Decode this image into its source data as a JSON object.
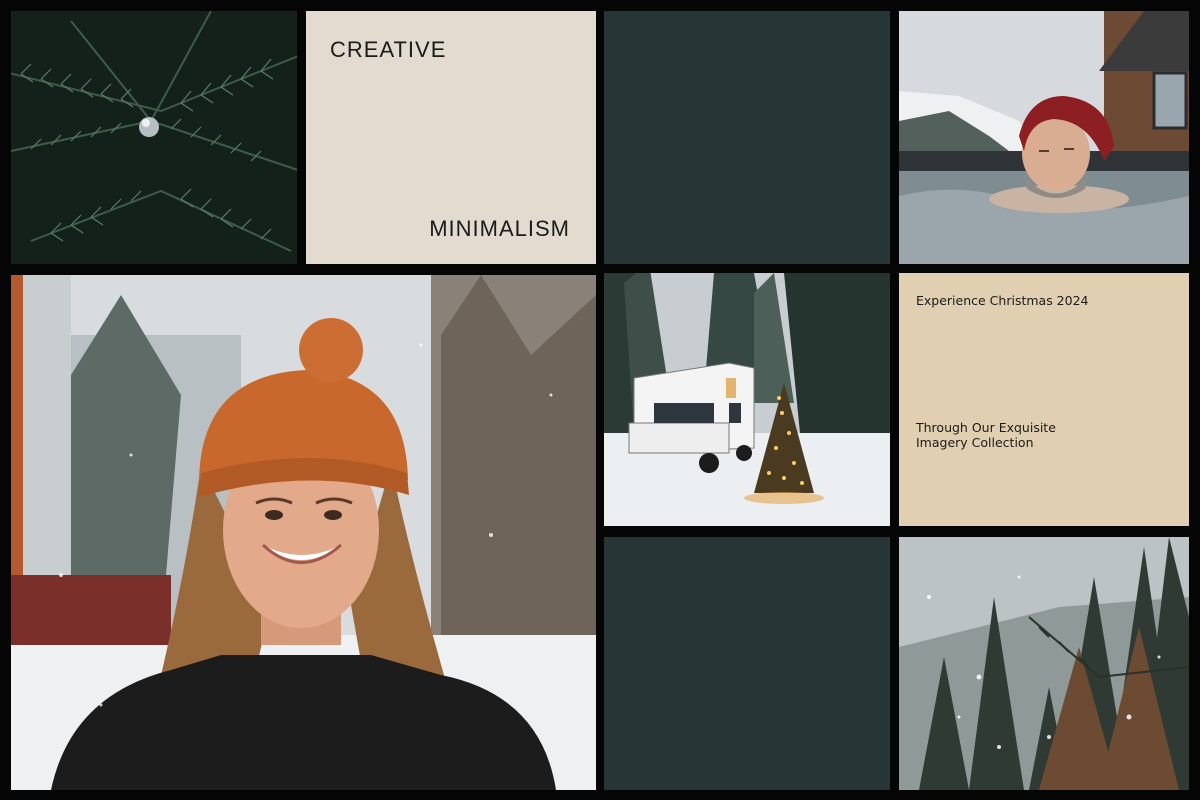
{
  "moodboard": {
    "creative_label": "CREATIVE",
    "minimalism_label": "MINIMALISM",
    "christmas_heading": "Experience Christmas 2024",
    "christmas_sub": [
      "Through Our Exquisite",
      "Imagery Collection"
    ]
  },
  "photos": {
    "pine_ornament": "pine-branch-with-ornament-photo",
    "hot_tub_man": "man-in-hot-tub-photo",
    "smiling_woman": "woman-in-orange-beanie-photo",
    "rv_christmas_tree": "rv-with-christmas-tree-photo",
    "snowy_forest": "snowy-forest-photo"
  },
  "colors": {
    "background": "#050505",
    "creative_panel": "#e3dbcf",
    "dark_panel": "#263536",
    "christmas_panel": "#e1cfb1",
    "text": "#1b1b1b"
  }
}
